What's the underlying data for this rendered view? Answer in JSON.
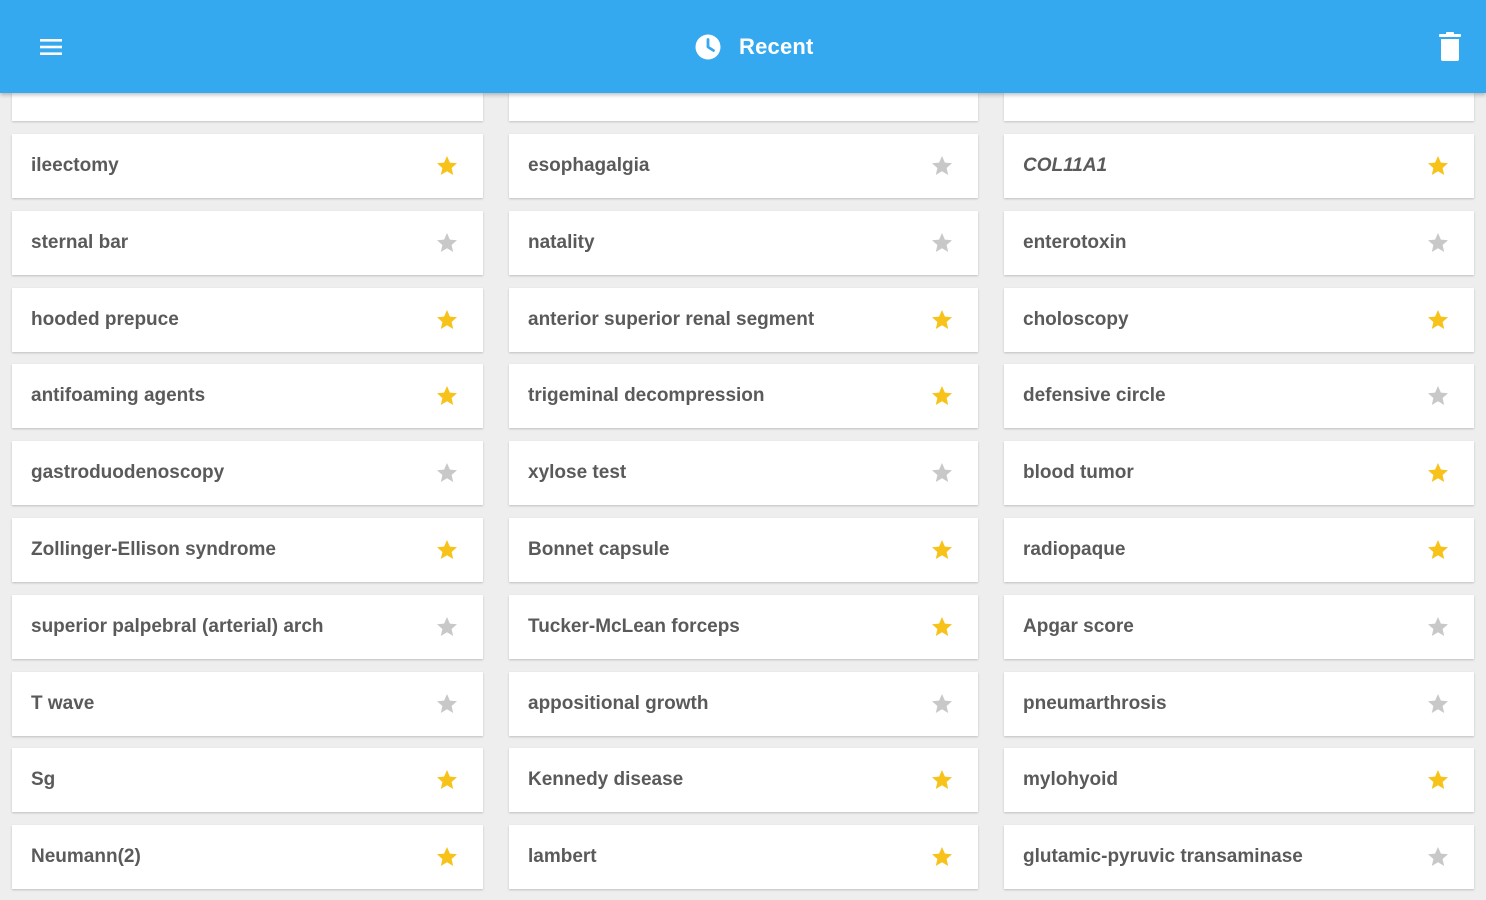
{
  "app_bar": {
    "title": "Recent",
    "menu_icon": "menu-icon",
    "title_icon": "clock-icon",
    "delete_icon": "trash-icon",
    "background": "#35a9ef"
  },
  "colors": {
    "star_on": "#f7c21a",
    "star_off": "#c8c8c8",
    "term_text": "#5a5a5a"
  },
  "columns": [
    [
      {
        "term": "ileectomy",
        "starred": true
      },
      {
        "term": "sternal bar",
        "starred": false
      },
      {
        "term": "hooded prepuce",
        "starred": true
      },
      {
        "term": "antifoaming agents",
        "starred": true
      },
      {
        "term": "gastroduodenoscopy",
        "starred": false
      },
      {
        "term": "Zollinger-Ellison syndrome",
        "starred": true
      },
      {
        "term": "superior palpebral (arterial) arch",
        "starred": false
      },
      {
        "term": "T wave",
        "starred": false
      },
      {
        "term": "Sg",
        "starred": true
      },
      {
        "term": "Neumann(2)",
        "starred": true
      }
    ],
    [
      {
        "term": "esophagalgia",
        "starred": false
      },
      {
        "term": "natality",
        "starred": false
      },
      {
        "term": "anterior superior renal segment",
        "starred": true
      },
      {
        "term": "trigeminal decompression",
        "starred": true
      },
      {
        "term": "xylose test",
        "starred": false
      },
      {
        "term": "Bonnet capsule",
        "starred": true
      },
      {
        "term": "Tucker-McLean forceps",
        "starred": true
      },
      {
        "term": "appositional growth",
        "starred": false
      },
      {
        "term": "Kennedy disease",
        "starred": true
      },
      {
        "term": "lambert",
        "starred": true
      }
    ],
    [
      {
        "term": "COL11A1",
        "starred": true,
        "italic": true
      },
      {
        "term": "enterotoxin",
        "starred": false
      },
      {
        "term": "choloscopy",
        "starred": true
      },
      {
        "term": "defensive circle",
        "starred": false
      },
      {
        "term": "blood tumor",
        "starred": true
      },
      {
        "term": "radiopaque",
        "starred": true
      },
      {
        "term": "Apgar score",
        "starred": false
      },
      {
        "term": "pneumarthrosis",
        "starred": false
      },
      {
        "term": "mylohyoid",
        "starred": true
      },
      {
        "term": "glutamic-pyruvic transaminase",
        "starred": false
      }
    ]
  ]
}
